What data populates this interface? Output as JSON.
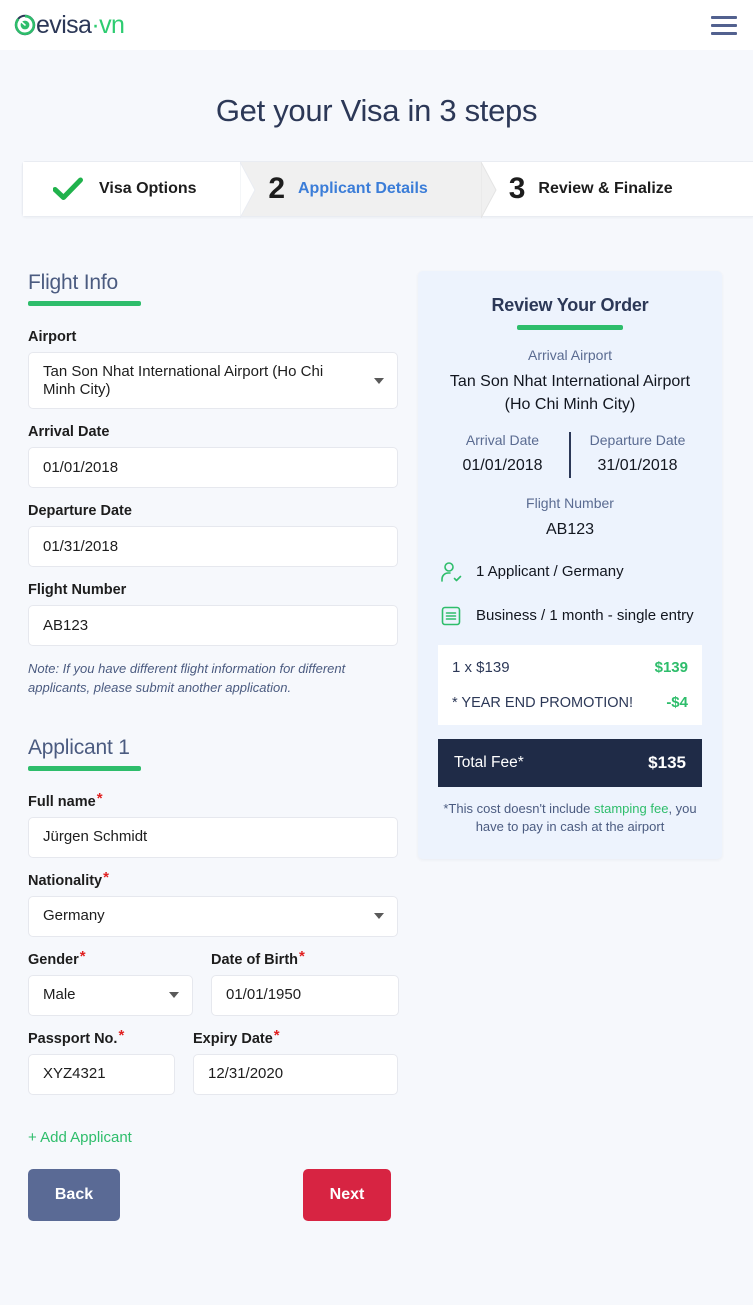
{
  "brand": {
    "name": "evisa",
    "tld": "·vn",
    "logo_icon": "evisa-circle-logo"
  },
  "header": {
    "menu_icon": "hamburger-menu-icon"
  },
  "page": {
    "title": "Get your Visa in 3 steps"
  },
  "stepper": {
    "steps": [
      {
        "indicator": "✔",
        "label": "Visa Options",
        "state": "complete",
        "icon": "check-icon"
      },
      {
        "indicator": "2",
        "label": "Applicant Details",
        "state": "current",
        "icon": "step-number"
      },
      {
        "indicator": "3",
        "label": "Review & Finalize",
        "state": "upcoming",
        "icon": "step-number"
      }
    ]
  },
  "form": {
    "flight_section": {
      "title": "Flight Info"
    },
    "airport": {
      "label": "Airport",
      "value": "Tan Son Nhat International Airport (Ho Chi Minh City)"
    },
    "arrival_date": {
      "label": "Arrival Date",
      "value": "01/01/2018"
    },
    "departure_date": {
      "label": "Departure Date",
      "value": "01/31/2018"
    },
    "flight_number": {
      "label": "Flight Number",
      "value": "AB123"
    },
    "note": "Note: If you have different flight information for different applicants, please submit another application.",
    "applicant_section": {
      "title": "Applicant 1"
    },
    "full_name": {
      "label": "Full name",
      "required": "*",
      "value": "Jürgen Schmidt"
    },
    "nationality": {
      "label": "Nationality",
      "required": "*",
      "value": "Germany"
    },
    "gender": {
      "label": "Gender",
      "required": "*",
      "value": "Male"
    },
    "date_of_birth": {
      "label": "Date of Birth",
      "required": "*",
      "value": "01/01/1950"
    },
    "passport_no": {
      "label": "Passport No.",
      "required": "*",
      "value": "XYZ4321"
    },
    "expiry_date": {
      "label": "Expiry Date",
      "required": "*",
      "value": "12/31/2020"
    },
    "add_applicant": "+ Add Applicant"
  },
  "order": {
    "title": "Review Your Order",
    "arrival_airport_label": "Arrival Airport",
    "arrival_airport_value": "Tan Son Nhat International Airport (Ho Chi Minh City)",
    "arrival_date_label": "Arrival Date",
    "arrival_date_value": "01/01/2018",
    "departure_date_label": "Departure Date",
    "departure_date_value": "31/01/2018",
    "flight_number_label": "Flight Number",
    "flight_number_value": "AB123",
    "applicants_summary": "1 Applicant / Germany",
    "applicants_icon": "user-check-icon",
    "visa_summary": "Business / 1 month - single entry",
    "visa_icon": "document-list-icon",
    "price_line_label": "1 x $139",
    "price_line_amount": "$139",
    "promo_label": "* YEAR END PROMOTION!",
    "promo_amount": "-$4",
    "total_label": "Total Fee*",
    "total_amount": "$135",
    "fine_print_pre": "*This cost doesn't include ",
    "fine_print_link": "stamping fee",
    "fine_print_post": ", you have to pay in cash at the airport"
  },
  "actions": {
    "back": "Back",
    "next": "Next"
  },
  "colors": {
    "brand_navy": "#2c3857",
    "green": "#2ebd6b",
    "blue_active": "#3b7dd8",
    "red": "#d72442",
    "slate": "#5a6a95",
    "panel_bg": "#edf3fd",
    "total_bg": "#1f2b47",
    "page_bg": "#f6f8fc"
  }
}
